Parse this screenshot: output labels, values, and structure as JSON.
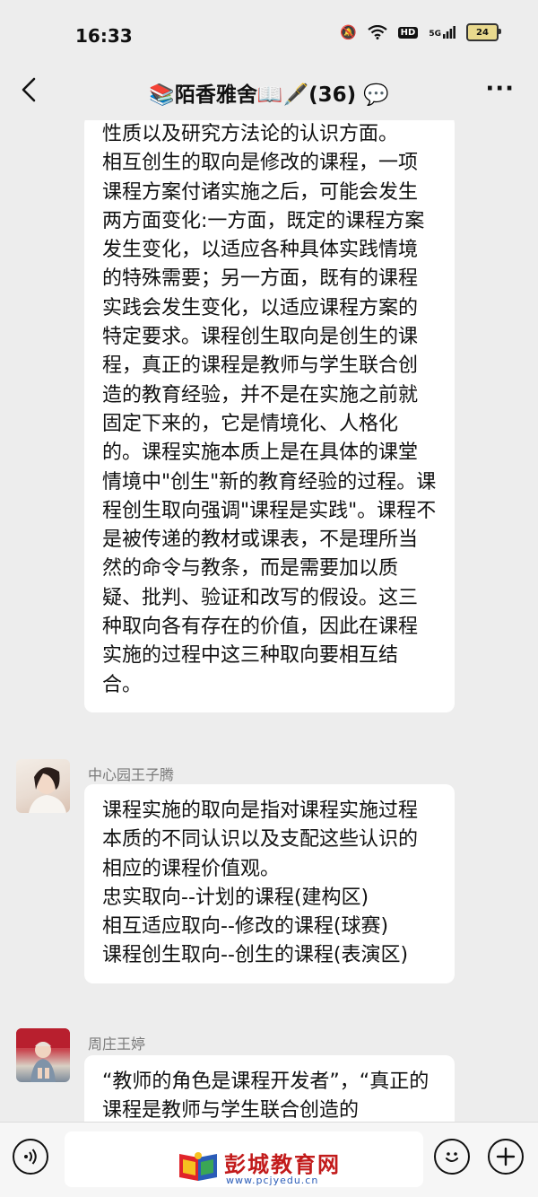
{
  "status_bar": {
    "time": "16:33",
    "hd": "HD",
    "network": "5G",
    "battery": "24",
    "icons": [
      "mute-icon",
      "wifi-icon",
      "signal-icon",
      "battery-icon"
    ]
  },
  "header": {
    "title": "📚陌香雅舍📖🖋️(36) 💬",
    "more_label": "···"
  },
  "messages": [
    {
      "sender": "",
      "text": "性质以及研究方法论的认识方面。\n相互创生的取向是修改的课程，一项课程方案付诸实施之后，可能会发生两方面变化:一方面，既定的课程方案发生变化，以适应各种具体实践情境的特殊需要；另一方面，既有的课程实践会发生变化，以适应课程方案的特定要求。课程创生取向是创生的课程，真正的课程是教师与学生联合创造的教育经验，并不是在实施之前就固定下来的，它是情境化、人格化的。课程实施本质上是在具体的课堂情境中\"创生\"新的教育经验的过程。课程创生取向强调\"课程是实践\"。课程不是被传递的教材或课表，不是理所当然的命令与教条，而是需要加以质疑、批判、验证和改写的假设。这三种取向各有存在的价值，因此在课程实施的过程中这三种取向要相互结合。"
    },
    {
      "sender": "中心园王子腾",
      "text": "课程实施的取向是指对课程实施过程本质的不同认识以及支配这些认识的相应的课程价值观。\n忠实取向--计划的课程(建构区)\n相互适应取向--修改的课程(球赛)\n课程创生取向--创生的课程(表演区)"
    },
    {
      "sender": "周庄王婷",
      "text": "“教师的角色是课程开发者”，“真正的课程是教师与学生联合创造的"
    }
  ],
  "watermark": {
    "name": "彭城教育网",
    "url": "www.pcjyedu.cn"
  },
  "colors": {
    "background": "#ededed",
    "bubble": "#ffffff",
    "watermark_red": "#c21b1b",
    "watermark_blue": "#2a5cb8"
  }
}
